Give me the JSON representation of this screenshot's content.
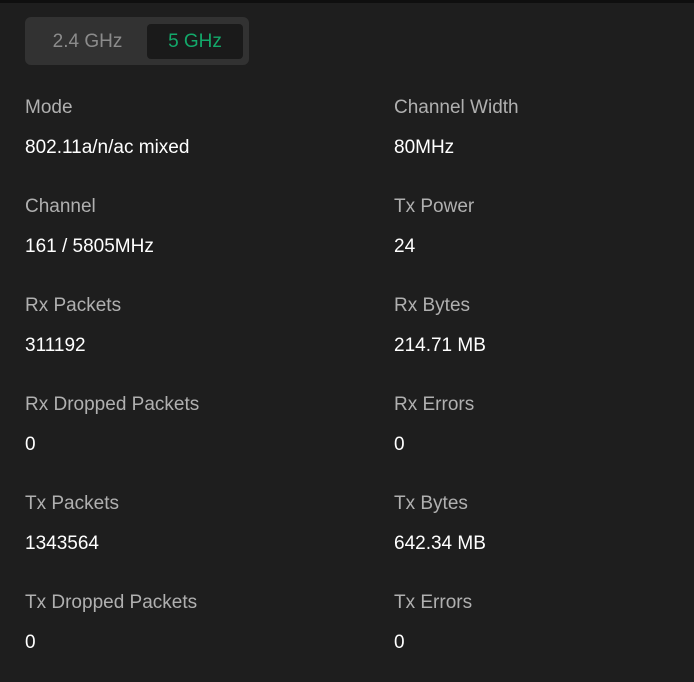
{
  "band_toggle": {
    "options": [
      "2.4 GHz",
      "5 GHz"
    ],
    "selected": "5 GHz"
  },
  "colors": {
    "background": "#1e1e1e",
    "active_accent": "#13a86a",
    "label": "#b0b0b0",
    "value": "#ffffff"
  },
  "stats": {
    "mode": {
      "label": "Mode",
      "value": "802.11a/n/ac mixed"
    },
    "channel_width": {
      "label": "Channel Width",
      "value": "80MHz"
    },
    "channel": {
      "label": "Channel",
      "value": "161 / 5805MHz"
    },
    "tx_power": {
      "label": "Tx Power",
      "value": "24"
    },
    "rx_packets": {
      "label": "Rx Packets",
      "value": "311192"
    },
    "rx_bytes": {
      "label": "Rx Bytes",
      "value": "214.71 MB"
    },
    "rx_dropped_packets": {
      "label": "Rx Dropped Packets",
      "value": "0"
    },
    "rx_errors": {
      "label": "Rx Errors",
      "value": "0"
    },
    "tx_packets": {
      "label": "Tx Packets",
      "value": "1343564"
    },
    "tx_bytes": {
      "label": "Tx Bytes",
      "value": "642.34 MB"
    },
    "tx_dropped_packets": {
      "label": "Tx Dropped Packets",
      "value": "0"
    },
    "tx_errors": {
      "label": "Tx Errors",
      "value": "0"
    }
  }
}
